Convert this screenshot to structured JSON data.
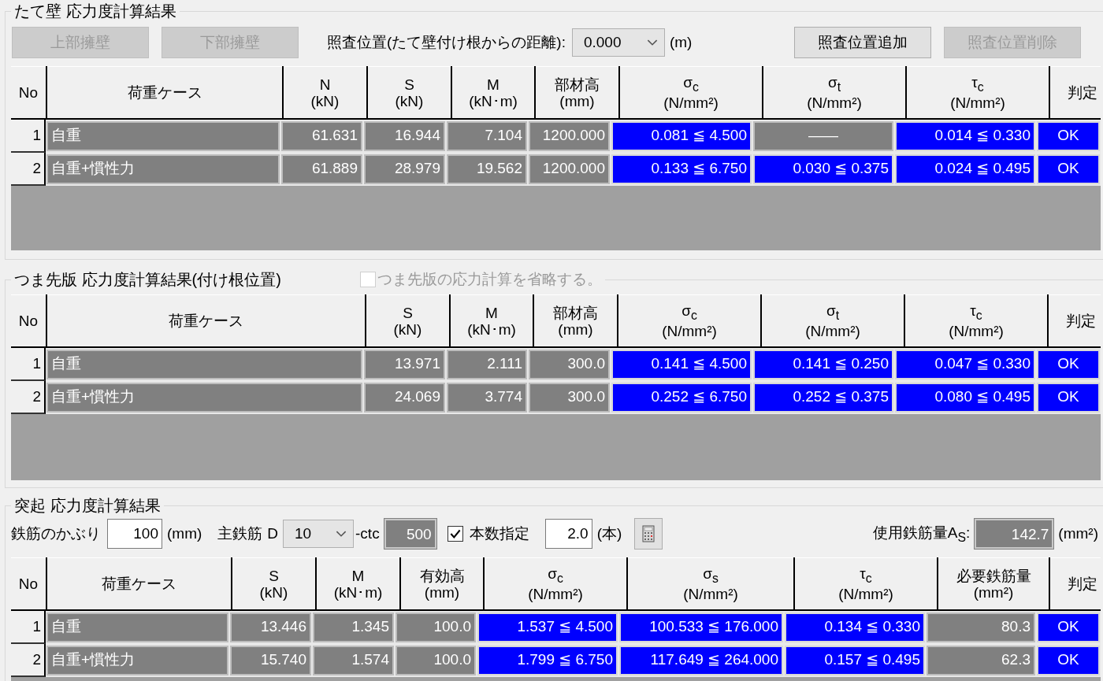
{
  "wall": {
    "title": "たて壁 応力度計算結果",
    "buttons": [
      {
        "label": "上部擁壁",
        "disabled": true
      },
      {
        "label": "下部擁壁",
        "disabled": true
      }
    ],
    "position_label": "照査位置(たて壁付け根からの距離):",
    "position_dropdown": {
      "value": "0.000"
    },
    "position_unit": "(m)",
    "action_buttons": [
      {
        "label": "照査位置追加",
        "disabled": false
      },
      {
        "label": "照査位置削除",
        "disabled": true
      }
    ],
    "table": {
      "columns": [
        {
          "label": "No"
        },
        {
          "label": "荷重ケース"
        },
        {
          "label": "N",
          "unit": "(kN)"
        },
        {
          "label": "S",
          "unit": "(kN)"
        },
        {
          "label": "M",
          "unit": "(kN･m)"
        },
        {
          "label": "部材高",
          "unit": "(mm)"
        },
        {
          "label": "σ$_{c}$",
          "unit": "(N/mm²)"
        },
        {
          "label": "σ$_{t}$",
          "unit": "(N/mm²)"
        },
        {
          "label": "τ$_{c}$",
          "unit": "(N/mm²)"
        },
        {
          "label": "判定"
        }
      ],
      "rows": [
        {
          "cells": [
            {
              "text": "1",
              "kind": "no"
            },
            {
              "text": "自重",
              "kind": "name"
            },
            {
              "text": "61.631",
              "kind": "num"
            },
            {
              "text": "16.944",
              "kind": "num"
            },
            {
              "text": "7.104",
              "kind": "num"
            },
            {
              "text": "1200.000",
              "kind": "num"
            },
            {
              "text": "0.081 ≦ 4.500",
              "kind": "check"
            },
            {
              "text": "——",
              "kind": "na"
            },
            {
              "text": "0.014 ≦ 0.330",
              "kind": "check"
            },
            {
              "text": "OK",
              "kind": "judge"
            }
          ]
        },
        {
          "cells": [
            {
              "text": "2",
              "kind": "no"
            },
            {
              "text": "自重+慣性力",
              "kind": "name"
            },
            {
              "text": "61.889",
              "kind": "num"
            },
            {
              "text": "28.979",
              "kind": "num"
            },
            {
              "text": "19.562",
              "kind": "num"
            },
            {
              "text": "1200.000",
              "kind": "num"
            },
            {
              "text": "0.133 ≦ 6.750",
              "kind": "check"
            },
            {
              "text": "0.030 ≦ 0.375",
              "kind": "check"
            },
            {
              "text": "0.024 ≦ 0.495",
              "kind": "check"
            },
            {
              "text": "OK",
              "kind": "judge"
            }
          ]
        }
      ]
    }
  },
  "toe": {
    "title": "つま先版 応力度計算結果(付け根位置)",
    "skip_checkbox": {
      "label": "つま先版の応力計算を省略する。",
      "checked": false,
      "disabled": true
    },
    "table": {
      "columns": [
        {
          "label": "No"
        },
        {
          "label": "荷重ケース"
        },
        {
          "label": "S",
          "unit": "(kN)"
        },
        {
          "label": "M",
          "unit": "(kN･m)"
        },
        {
          "label": "部材高",
          "unit": "(mm)"
        },
        {
          "label": "σ$_{c}$",
          "unit": "(N/mm²)"
        },
        {
          "label": "σ$_{t}$",
          "unit": "(N/mm²)"
        },
        {
          "label": "τ$_{c}$",
          "unit": "(N/mm²)"
        },
        {
          "label": "判定"
        }
      ],
      "rows": [
        {
          "cells": [
            {
              "text": "1",
              "kind": "no"
            },
            {
              "text": "自重",
              "kind": "name"
            },
            {
              "text": "13.971",
              "kind": "num"
            },
            {
              "text": "2.111",
              "kind": "num"
            },
            {
              "text": "300.0",
              "kind": "num"
            },
            {
              "text": "0.141 ≦ 4.500",
              "kind": "check"
            },
            {
              "text": "0.141 ≦ 0.250",
              "kind": "check"
            },
            {
              "text": "0.047 ≦ 0.330",
              "kind": "check"
            },
            {
              "text": "OK",
              "kind": "judge"
            }
          ]
        },
        {
          "cells": [
            {
              "text": "2",
              "kind": "no"
            },
            {
              "text": "自重+慣性力",
              "kind": "name"
            },
            {
              "text": "24.069",
              "kind": "num"
            },
            {
              "text": "3.774",
              "kind": "num"
            },
            {
              "text": "300.0",
              "kind": "num"
            },
            {
              "text": "0.252 ≦ 6.750",
              "kind": "check"
            },
            {
              "text": "0.252 ≦ 0.375",
              "kind": "check"
            },
            {
              "text": "0.080 ≦ 0.495",
              "kind": "check"
            },
            {
              "text": "OK",
              "kind": "judge"
            }
          ]
        }
      ]
    }
  },
  "projection": {
    "title": "突起 応力度計算結果",
    "cover_label": "鉄筋のかぶり",
    "cover_field": {
      "value": "100",
      "readonly": false
    },
    "cover_unit": "(mm)",
    "rebar_label": "主鉄筋",
    "diameter_prefix": "D",
    "diameter_dropdown": {
      "value": "10"
    },
    "ctc_label": "-ctc",
    "ctc_field": {
      "value": "500",
      "readonly": true
    },
    "count_checkbox": {
      "label": "本数指定",
      "checked": true,
      "disabled": false
    },
    "count_field": {
      "value": "2.0",
      "readonly": false
    },
    "count_unit": "(本)",
    "area_label": "使用鉄筋量A$_{S}$:",
    "area_field": {
      "value": "142.7",
      "readonly": true
    },
    "area_unit": "(mm²)",
    "table": {
      "columns": [
        {
          "label": "No"
        },
        {
          "label": "荷重ケース"
        },
        {
          "label": "S",
          "unit": "(kN)"
        },
        {
          "label": "M",
          "unit": "(kN･m)"
        },
        {
          "label": "有効高",
          "unit": "(mm)"
        },
        {
          "label": "σ$_{c}$",
          "unit": "(N/mm²)"
        },
        {
          "label": "σ$_{s}$",
          "unit": "(N/mm²)"
        },
        {
          "label": "τ$_{c}$",
          "unit": "(N/mm²)"
        },
        {
          "label": "必要鉄筋量",
          "unit": "(mm²)"
        },
        {
          "label": "判定"
        }
      ],
      "rows": [
        {
          "cells": [
            {
              "text": "1",
              "kind": "no"
            },
            {
              "text": "自重",
              "kind": "name"
            },
            {
              "text": "13.446",
              "kind": "num"
            },
            {
              "text": "1.345",
              "kind": "num"
            },
            {
              "text": "100.0",
              "kind": "num"
            },
            {
              "text": "1.537 ≦ 4.500",
              "kind": "check"
            },
            {
              "text": "100.533 ≦ 176.000",
              "kind": "check"
            },
            {
              "text": "0.134 ≦ 0.330",
              "kind": "check"
            },
            {
              "text": "80.3",
              "kind": "num"
            },
            {
              "text": "OK",
              "kind": "judge"
            }
          ]
        },
        {
          "cells": [
            {
              "text": "2",
              "kind": "no"
            },
            {
              "text": "自重+慣性力",
              "kind": "name"
            },
            {
              "text": "15.740",
              "kind": "num"
            },
            {
              "text": "1.574",
              "kind": "num"
            },
            {
              "text": "100.0",
              "kind": "num"
            },
            {
              "text": "1.799 ≦ 6.750",
              "kind": "check"
            },
            {
              "text": "117.649 ≦ 264.000",
              "kind": "check"
            },
            {
              "text": "0.157 ≦ 0.495",
              "kind": "check"
            },
            {
              "text": "62.3",
              "kind": "num"
            },
            {
              "text": "OK",
              "kind": "judge"
            }
          ]
        }
      ]
    }
  }
}
